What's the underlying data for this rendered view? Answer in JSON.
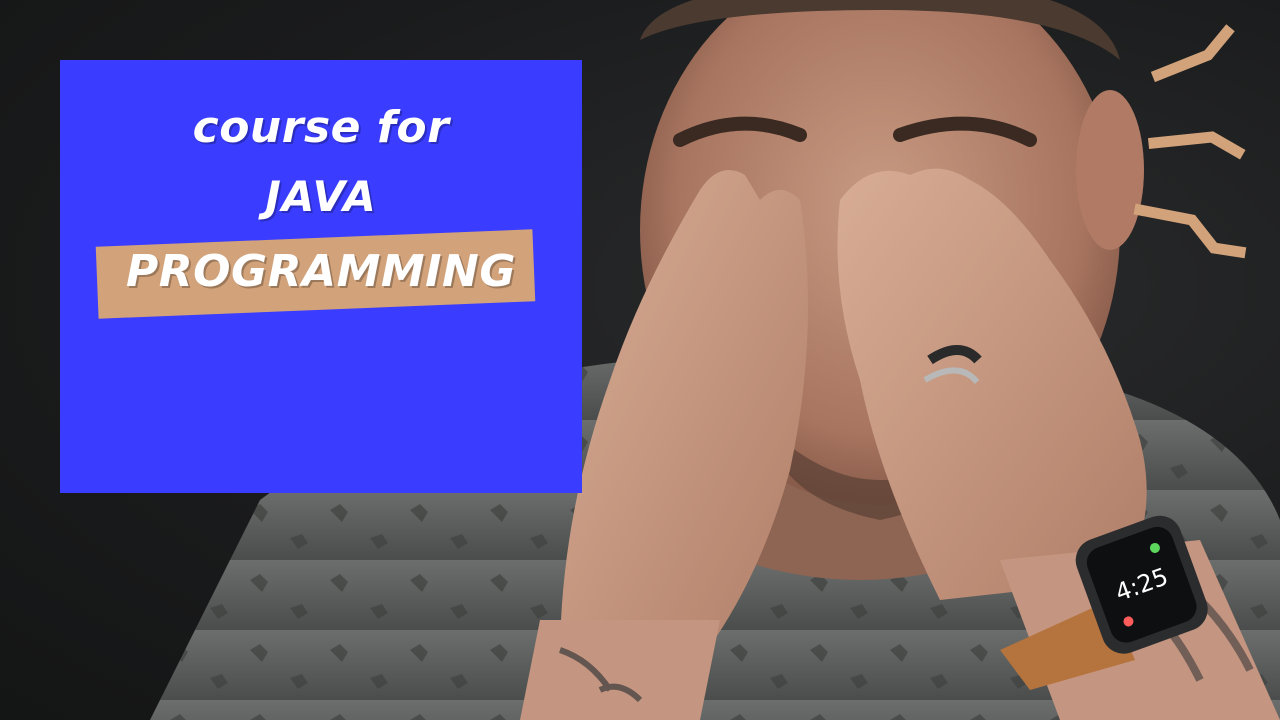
{
  "thumbnail": {
    "line1": "course for",
    "line2": "JAVA",
    "line3": "PROGRAMMING"
  },
  "colors": {
    "panel": "#3a3cff",
    "highlight": "#d2a27a",
    "text": "#ffffff",
    "background": "#1b1c1d"
  },
  "watch": {
    "time": "4:25"
  }
}
